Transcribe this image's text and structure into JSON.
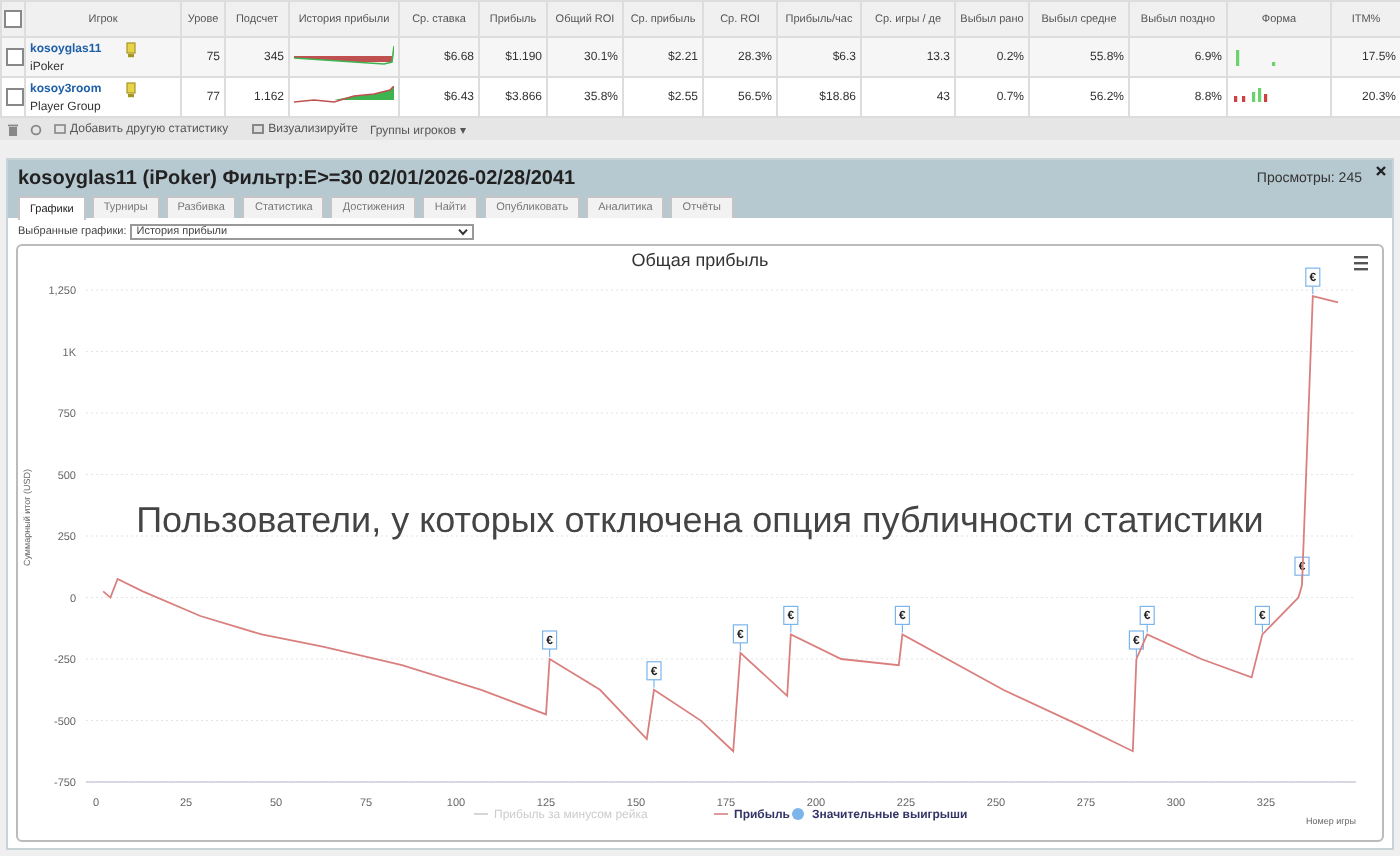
{
  "table": {
    "select_all": {
      "checked": false
    },
    "columns": [
      "Игрок",
      "Урове",
      "Подсчет",
      "История прибыли",
      "Ср. ставка",
      "Прибыль",
      "Общий ROI",
      "Ср. прибыль",
      "Ср. ROI",
      "Прибыль/час",
      "Ср. игры / де",
      "Выбыл рано",
      "Выбыл средне",
      "Выбыл поздно",
      "Форма",
      "ITM%"
    ],
    "rows": [
      {
        "checked": false,
        "cells": [
          {
            "kind": "player",
            "text": "kosoyglas11",
            "sub": "iPoker"
          },
          {
            "kind": "text",
            "text": "75"
          },
          {
            "kind": "text",
            "text": "345"
          },
          {
            "kind": "sparkline"
          },
          {
            "kind": "text",
            "text": "$6.68"
          },
          {
            "kind": "text",
            "text": "$1.190"
          },
          {
            "kind": "text",
            "text": "30.1%"
          },
          {
            "kind": "text",
            "text": "$2.21"
          },
          {
            "kind": "text",
            "text": "28.3%"
          },
          {
            "kind": "text",
            "text": "$6.3"
          },
          {
            "kind": "text",
            "text": "13.3"
          },
          {
            "kind": "text",
            "text": "0.2%"
          },
          {
            "kind": "text",
            "text": "55.8%"
          },
          {
            "kind": "text",
            "text": "6.9%"
          },
          {
            "kind": "form"
          },
          {
            "kind": "text",
            "text": "17.5%"
          }
        ]
      },
      {
        "checked": false,
        "cells": [
          {
            "kind": "player",
            "text": "kosoy3room",
            "sub": "Player Group"
          },
          {
            "kind": "text",
            "text": "77"
          },
          {
            "kind": "text",
            "text": "1.162"
          },
          {
            "kind": "sparkline"
          },
          {
            "kind": "text",
            "text": "$6.43"
          },
          {
            "kind": "text",
            "text": "$3.866"
          },
          {
            "kind": "text",
            "text": "35.8%"
          },
          {
            "kind": "text",
            "text": "$2.55"
          },
          {
            "kind": "text",
            "text": "56.5%"
          },
          {
            "kind": "text",
            "text": "$18.86"
          },
          {
            "kind": "text",
            "text": "43"
          },
          {
            "kind": "text",
            "text": "0.7%"
          },
          {
            "kind": "text",
            "text": "56.2%"
          },
          {
            "kind": "text",
            "text": "8.8%"
          },
          {
            "kind": "form"
          },
          {
            "kind": "text",
            "text": "20.3%"
          }
        ]
      }
    ]
  },
  "toolbar": {
    "add_stat": "Добавить другую статистику",
    "visualize": "Визуализируйте",
    "groups": "Группы игроков ▾"
  },
  "panel": {
    "title": "kosoyglas11 (iPoker) Фильтр:E>=30 02/01/2026-02/28/2041",
    "views": "Просмотры: 245",
    "tabs": [
      {
        "label": "Графики",
        "selected": true
      },
      {
        "label": "Турниры",
        "selected": false
      },
      {
        "label": "Разбивка",
        "selected": false
      },
      {
        "label": "Статистика",
        "selected": false
      },
      {
        "label": "Достижения",
        "selected": false
      },
      {
        "label": "Найти",
        "selected": false
      },
      {
        "label": "Опубликовать",
        "selected": false
      },
      {
        "label": "Аналитика",
        "selected": false
      },
      {
        "label": "Отчёты",
        "selected": false
      }
    ],
    "select_label": "Выбранные графики:",
    "select_value": "История прибыли",
    "notice": "Пользователи, у которых отключена опция публичности статистики",
    "hidden_legend_item": {
      "label": "Прибыль за минусом рейка",
      "hidden": true
    },
    "markers_legend_item": {
      "label": "Значительные выигрыши"
    },
    "chart_data": {
      "type": "line",
      "title": "Общая прибыль",
      "xlabel": "Номер игры",
      "ylabel": "Суммарный итог (USD)",
      "grid": true,
      "legend": "bottom",
      "x": [
        2,
        4,
        6,
        13,
        29,
        46,
        63,
        85,
        107,
        125,
        126,
        140,
        153,
        155,
        168,
        177,
        179,
        192,
        193,
        207,
        223,
        224,
        252,
        274,
        288,
        289,
        292,
        307,
        321,
        324,
        334,
        335,
        338,
        345
      ],
      "series": [
        {
          "name": "Прибыль",
          "color": "#d9807f",
          "values": [
            25,
            0,
            75,
            25,
            -75,
            -150,
            -200,
            -275,
            -375,
            -475,
            -250,
            -375,
            -575,
            -375,
            -500,
            -625,
            -225,
            -400,
            -150,
            -250,
            -275,
            -150,
            -375,
            -525,
            -625,
            -250,
            -150,
            -250,
            -325,
            -150,
            0,
            50,
            1225,
            1200
          ]
        }
      ],
      "annotations": [
        {
          "x": 126,
          "y": -250,
          "text": "€"
        },
        {
          "x": 155,
          "y": -375,
          "text": "€"
        },
        {
          "x": 179,
          "y": -225,
          "text": "€"
        },
        {
          "x": 193,
          "y": -150,
          "text": "€"
        },
        {
          "x": 224,
          "y": -150,
          "text": "€"
        },
        {
          "x": 289,
          "y": -250,
          "text": "€"
        },
        {
          "x": 292,
          "y": -150,
          "text": "€"
        },
        {
          "x": 324,
          "y": -150,
          "text": "€"
        },
        {
          "x": 335,
          "y": 50,
          "text": "€"
        },
        {
          "x": 338,
          "y": 1225,
          "text": "€"
        }
      ],
      "xlim": [
        0,
        350
      ],
      "ylim": [
        -750,
        1250
      ],
      "xticks": [
        0,
        25,
        50,
        75,
        100,
        125,
        150,
        175,
        200,
        225,
        250,
        275,
        300,
        325
      ],
      "yticks": [
        {
          "value": 1250,
          "label": "1,250"
        },
        {
          "value": 1000,
          "label": "1K"
        },
        750,
        500,
        250,
        0,
        -250,
        -500,
        -750
      ]
    }
  }
}
